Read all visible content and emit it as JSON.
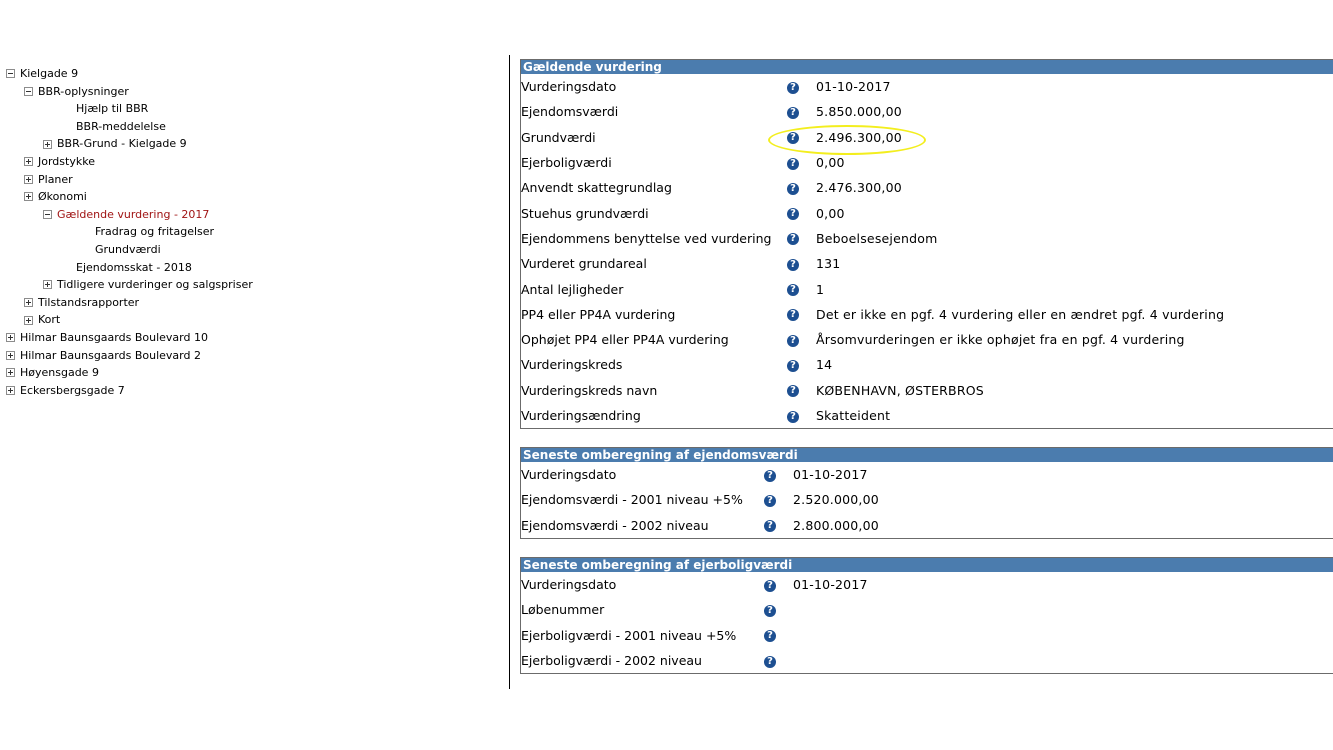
{
  "tree": [
    {
      "level": 0,
      "toggle": "minus",
      "label": "Kielgade 9"
    },
    {
      "level": 1,
      "toggle": "minus",
      "label": "BBR-oplysninger"
    },
    {
      "level": 3,
      "toggle": "none",
      "label": "Hjælp til BBR"
    },
    {
      "level": 3,
      "toggle": "none",
      "label": "BBR-meddelelse"
    },
    {
      "level": 2,
      "toggle": "plus",
      "label": "BBR-Grund - Kielgade 9"
    },
    {
      "level": 1,
      "toggle": "plus",
      "label": "Jordstykke"
    },
    {
      "level": 1,
      "toggle": "plus",
      "label": "Planer"
    },
    {
      "level": 1,
      "toggle": "plus",
      "label": "Økonomi"
    },
    {
      "level": 2,
      "toggle": "minus",
      "label": "Gældende vurdering - 2017",
      "active": true
    },
    {
      "level": 3,
      "toggle": "none",
      "label": "Fradrag og fritagelser",
      "indent_extra": true
    },
    {
      "level": 3,
      "toggle": "none",
      "label": "Grundværdi",
      "indent_extra": true
    },
    {
      "level": 3,
      "toggle": "none",
      "label": "Ejendomsskat - 2018"
    },
    {
      "level": 2,
      "toggle": "plus",
      "label": "Tidligere vurderinger og salgspriser"
    },
    {
      "level": 1,
      "toggle": "plus",
      "label": "Tilstandsrapporter"
    },
    {
      "level": 1,
      "toggle": "plus",
      "label": "Kort"
    },
    {
      "level": 0,
      "toggle": "plus",
      "label": "Hilmar Baunsgaards Boulevard 10"
    },
    {
      "level": 0,
      "toggle": "plus",
      "label": "Hilmar Baunsgaards Boulevard 2"
    },
    {
      "level": 0,
      "toggle": "plus",
      "label": "Høyensgade 9"
    },
    {
      "level": 0,
      "toggle": "plus",
      "label": "Eckersbergsgade 7"
    }
  ],
  "help_icon": "question-circle-icon",
  "panels": [
    {
      "title": "Gældende vurdering",
      "rows": [
        {
          "label": "Vurderingsdato",
          "value": "01-10-2017"
        },
        {
          "label": "Ejendomsværdi",
          "value": "5.850.000,00"
        },
        {
          "label": "Grundværdi",
          "value": "2.496.300,00",
          "highlighted": true
        },
        {
          "label": "Ejerboligværdi",
          "value": "0,00"
        },
        {
          "label": "Anvendt skattegrundlag",
          "value": "2.476.300,00"
        },
        {
          "label": "Stuehus grundværdi",
          "value": "0,00"
        },
        {
          "label": "Ejendommens benyttelse ved vurdering",
          "value": "Beboelsesejendom"
        },
        {
          "label": "Vurderet grundareal",
          "value": "131"
        },
        {
          "label": "Antal lejligheder",
          "value": "1"
        },
        {
          "label": "PP4 eller PP4A vurdering",
          "value": "Det er ikke en pgf. 4 vurdering eller en ændret pgf. 4 vurdering"
        },
        {
          "label": "Ophøjet PP4 eller PP4A vurdering",
          "value": "Årsomvurderingen er ikke ophøjet fra en pgf. 4 vurdering"
        },
        {
          "label": "Vurderingskreds",
          "value": "14"
        },
        {
          "label": "Vurderingskreds navn",
          "value": "KØBENHAVN, ØSTERBROS"
        },
        {
          "label": "Vurderingsændring",
          "value": "Skatteident"
        }
      ]
    },
    {
      "title": "Seneste omberegning af ejendomsværdi",
      "rows": [
        {
          "label": "Vurderingsdato",
          "value": "01-10-2017"
        },
        {
          "label": "Ejendomsværdi - 2001 niveau +5%",
          "value": "2.520.000,00"
        },
        {
          "label": "Ejendomsværdi - 2002 niveau",
          "value": "2.800.000,00"
        }
      ]
    },
    {
      "title": "Seneste omberegning af ejerboligværdi",
      "rows": [
        {
          "label": "Vurderingsdato",
          "value": "01-10-2017"
        },
        {
          "label": "Løbenummer",
          "value": ""
        },
        {
          "label": "Ejerboligværdi - 2001 niveau +5%",
          "value": ""
        },
        {
          "label": "Ejerboligværdi - 2002 niveau",
          "value": ""
        }
      ]
    }
  ]
}
